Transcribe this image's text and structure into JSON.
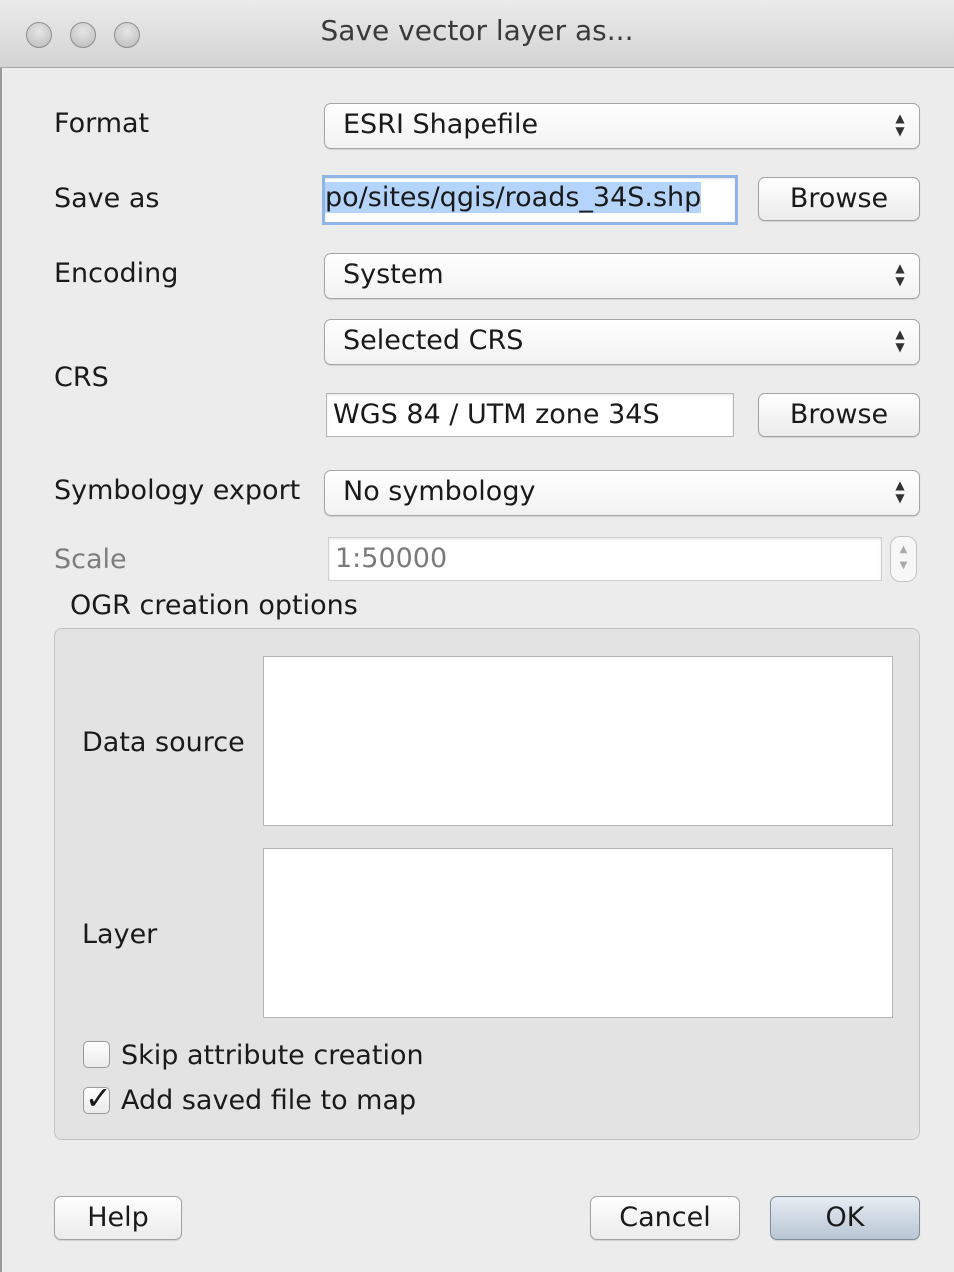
{
  "window": {
    "title": "Save vector layer as..."
  },
  "form": {
    "format": {
      "label": "Format",
      "value": "ESRI Shapefile"
    },
    "save_as": {
      "label": "Save as",
      "value": "po/sites/qgis/roads_34S.shp",
      "browse_label": "Browse"
    },
    "encoding": {
      "label": "Encoding",
      "value": "System"
    },
    "crs": {
      "label": "CRS",
      "mode": "Selected CRS",
      "value": "WGS 84 / UTM zone 34S",
      "browse_label": "Browse"
    },
    "symbology": {
      "label": "Symbology export",
      "value": "No symbology"
    },
    "scale": {
      "label": "Scale",
      "value": "1:50000",
      "enabled": false
    }
  },
  "ogr": {
    "title": "OGR creation options",
    "data_source_label": "Data source",
    "data_source_value": "",
    "layer_label": "Layer",
    "layer_value": ""
  },
  "options": {
    "skip_attr": {
      "label": "Skip attribute creation",
      "checked": false
    },
    "add_to_map": {
      "label": "Add saved file to map",
      "checked": true
    }
  },
  "buttons": {
    "help": "Help",
    "cancel": "Cancel",
    "ok": "OK"
  },
  "icons": {
    "check": "✓",
    "combo_arrows": "▲▼",
    "stepper_arrows": "▲▼"
  }
}
